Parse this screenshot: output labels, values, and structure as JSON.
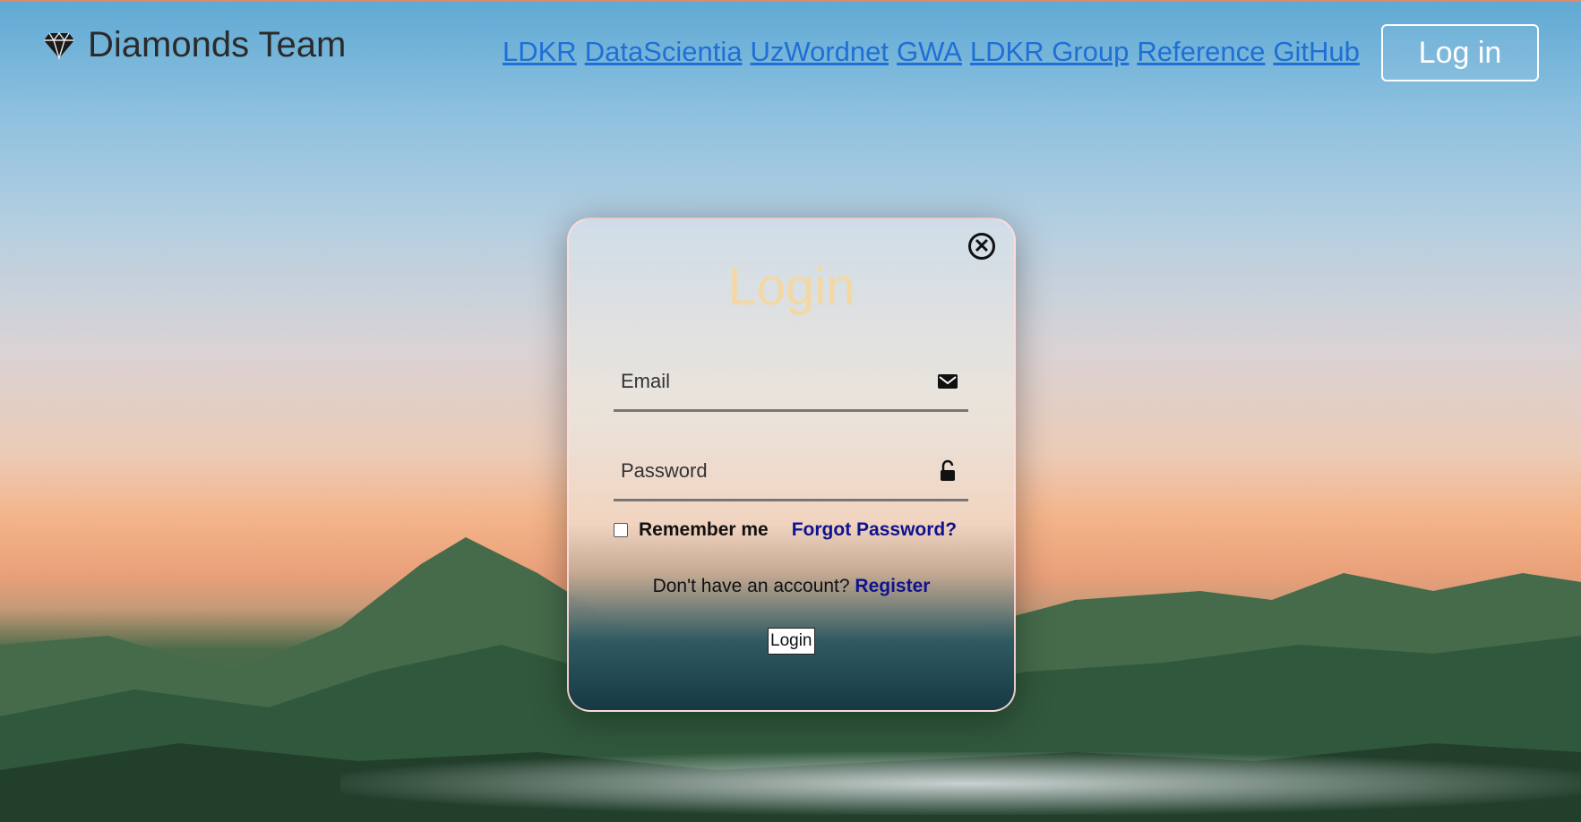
{
  "brand": {
    "name": "Diamonds Team",
    "icon": "diamond-icon"
  },
  "nav": {
    "links": [
      "LDKR",
      "DataScientia",
      "UzWordnet",
      "GWA",
      "LDKR Group",
      "Reference",
      "GitHub"
    ],
    "login_label": "Log in"
  },
  "modal": {
    "title": "Login",
    "close_icon": "close-icon",
    "email": {
      "placeholder": "Email",
      "icon": "envelope-icon"
    },
    "password": {
      "placeholder": "Password",
      "icon": "lock-icon"
    },
    "remember_label": "Remember me",
    "forgot_label": "Forgot Password?",
    "register_prompt": "Don't have an account?",
    "register_label": "Register",
    "submit_label": "Login"
  },
  "colors": {
    "link": "#1f6fd6",
    "title": "#f3d8a4",
    "accent_link": "#10128f"
  }
}
